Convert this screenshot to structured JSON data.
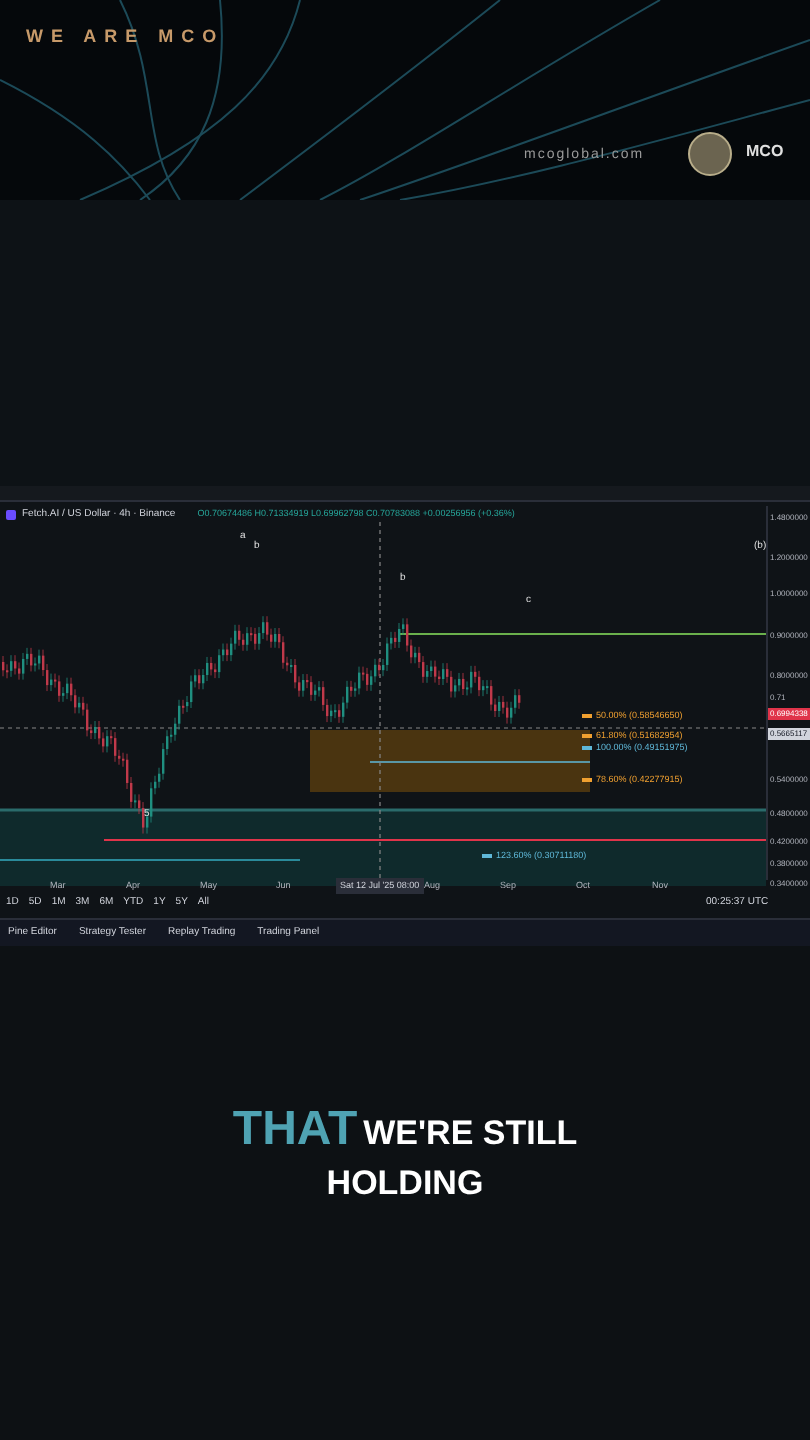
{
  "brand": {
    "tagline": "WE ARE MCO",
    "website": "mcoglobal.com",
    "logo_text": "MCO"
  },
  "chart": {
    "symbol": "Fetch.AI / US Dollar · 4h · Binance",
    "ohlc": "O0.70674486 H0.71334919 L0.69962798 C0.70783088 +0.00256956 (+0.36%)",
    "price_labels": [
      "1.4800000",
      "1.2000000",
      "1.0000000",
      "0.9000000",
      "0.8000000",
      "0.71",
      "0.5400000",
      "0.4800000",
      "0.4200000",
      "0.3800000",
      "0.3400000"
    ],
    "last_price": "0.6994338",
    "cursor_price": "0.5665117",
    "fib_levels": [
      {
        "text": "50.00% (0.58546650)",
        "color": "#f0a030"
      },
      {
        "text": "61.80% (0.51682954)",
        "color": "#f0a030"
      },
      {
        "text": "100.00% (0.49151975)",
        "color": "#5fb8d8"
      },
      {
        "text": "78.60% (0.42277915)",
        "color": "#f0a030"
      },
      {
        "text": "123.60% (0.30711180)",
        "color": "#5fb8d8"
      }
    ],
    "wave_labels": [
      "a",
      "b",
      "(b)",
      "b",
      "c",
      "5"
    ],
    "time_labels": [
      "Mar",
      "Apr",
      "May",
      "Jun",
      "Aug",
      "Sep",
      "Oct",
      "Nov"
    ],
    "cursor_time": "Sat 12 Jul '25 08:00",
    "ranges": [
      "1D",
      "5D",
      "1M",
      "3M",
      "6M",
      "YTD",
      "1Y",
      "5Y",
      "All"
    ],
    "clock": "00:25:37 UTC",
    "panel_tabs": [
      "Pine Editor",
      "Strategy Tester",
      "Replay Trading",
      "Trading Panel"
    ]
  },
  "caption": {
    "highlight": "THAT",
    "rest": "WE'RE STILL",
    "line2": "HOLDING"
  }
}
